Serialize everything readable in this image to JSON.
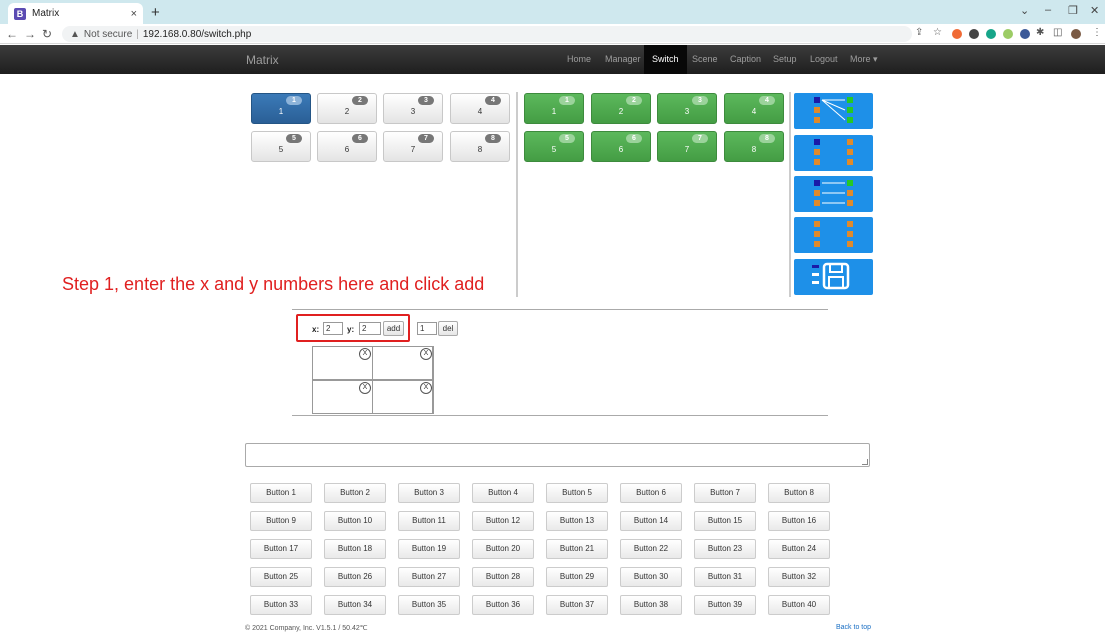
{
  "browser": {
    "tab_icon": "B",
    "tab_title": "Matrix",
    "tab_close": "×",
    "new_tab": "+",
    "not_secure": "Not secure",
    "url": "192.168.0.80/switch.php"
  },
  "navbar": {
    "brand": "Matrix",
    "items": [
      {
        "label": "Home"
      },
      {
        "label": "Manager"
      },
      {
        "label": "Switch"
      },
      {
        "label": "Scene"
      },
      {
        "label": "Caption"
      },
      {
        "label": "Setup"
      },
      {
        "label": "Logout"
      },
      {
        "label": "More ▾"
      }
    ]
  },
  "inputs": [
    {
      "label": "1",
      "badge": "1"
    },
    {
      "label": "2",
      "badge": "2"
    },
    {
      "label": "3",
      "badge": "3"
    },
    {
      "label": "4",
      "badge": "4"
    },
    {
      "label": "5",
      "badge": "5"
    },
    {
      "label": "6",
      "badge": "6"
    },
    {
      "label": "7",
      "badge": "7"
    },
    {
      "label": "8",
      "badge": "8"
    }
  ],
  "outputs": [
    {
      "label": "1",
      "badge": "1"
    },
    {
      "label": "2",
      "badge": "2"
    },
    {
      "label": "3",
      "badge": "3"
    },
    {
      "label": "4",
      "badge": "4"
    },
    {
      "label": "5",
      "badge": "5"
    },
    {
      "label": "6",
      "badge": "6"
    },
    {
      "label": "7",
      "badge": "7"
    },
    {
      "label": "8",
      "badge": "8"
    }
  ],
  "annotation": "Step 1, enter the x and y numbers here and click add",
  "layout_editor": {
    "x_label": "x:",
    "x_value": "2",
    "y_label": "y:",
    "y_value": "2",
    "add_label": "add",
    "del_value": "1",
    "del_label": "del",
    "cell_close": "X"
  },
  "buttons": [
    "Button 1",
    "Button 2",
    "Button 3",
    "Button 4",
    "Button 5",
    "Button 6",
    "Button 7",
    "Button 8",
    "Button 9",
    "Button 10",
    "Button 11",
    "Button 12",
    "Button 13",
    "Button 14",
    "Button 15",
    "Button 16",
    "Button 17",
    "Button 18",
    "Button 19",
    "Button 20",
    "Button 21",
    "Button 22",
    "Button 23",
    "Button 24",
    "Button 25",
    "Button 26",
    "Button 27",
    "Button 28",
    "Button 29",
    "Button 30",
    "Button 31",
    "Button 32",
    "Button 33",
    "Button 34",
    "Button 35",
    "Button 36",
    "Button 37",
    "Button 38",
    "Button 39",
    "Button 40"
  ],
  "footer": {
    "copyright": "© 2021 Company, Inc. V1.5.1 / 50.42℃",
    "back_to_top": "Back to top"
  },
  "action_buttons": [
    {
      "name": "route-cross-icon"
    },
    {
      "name": "route-none-icon"
    },
    {
      "name": "route-straight-icon"
    },
    {
      "name": "route-clear-icon"
    },
    {
      "name": "save-layout-icon"
    }
  ]
}
